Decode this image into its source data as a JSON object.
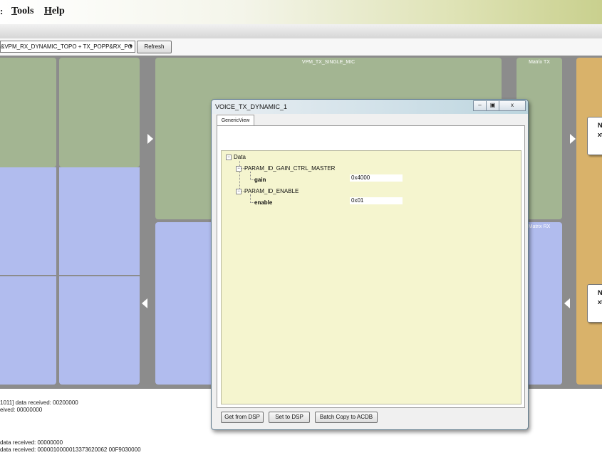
{
  "menu": {
    "items": [
      {
        "accel": "T",
        "rest": "ools"
      },
      {
        "accel": "H",
        "rest": "elp"
      }
    ]
  },
  "toolbar": {
    "combo_value": "&VPM_RX_DYNAMIC_TOPO + TX_POPP&RX_PO",
    "refresh_label": "Refresh"
  },
  "diagram": {
    "tx_block_title": "VPM_TX_SINGLE_MIC",
    "matrix_tx_title": "Matrix TX",
    "matrix_rx_title": "Matrix RX",
    "endpoint_top": {
      "line1": "N",
      "line2": "xt"
    },
    "endpoint_bottom": {
      "line1": "N",
      "line2": "xt"
    },
    "colors": {
      "green": "#a3b592",
      "blue": "#b1bcee",
      "orange": "#d9b26a",
      "background": "#8c8c8c"
    }
  },
  "log": {
    "lines": [
      "1011] data received: 00200000",
      "eived: 00000000",
      "data received: 00000000",
      "data received: 0000010000013373620062 00F9030000"
    ]
  },
  "dialog": {
    "title": "VOICE_TX_DYNAMIC_1",
    "tab_label": "GenericView",
    "tree": {
      "root": "Data",
      "params": [
        {
          "name": "PARAM_ID_GAIN_CTRL_MASTER",
          "field": "gain",
          "value": "0x4000"
        },
        {
          "name": "PARAM_ID_ENABLE",
          "field": "enable",
          "value": "0x01"
        }
      ]
    },
    "buttons": {
      "get": "Get from DSP",
      "set": "Set to DSP",
      "batch": "Batch Copy to ACDB"
    },
    "window_buttons": {
      "minimize": "–",
      "restore": "▣",
      "close": "x"
    }
  }
}
